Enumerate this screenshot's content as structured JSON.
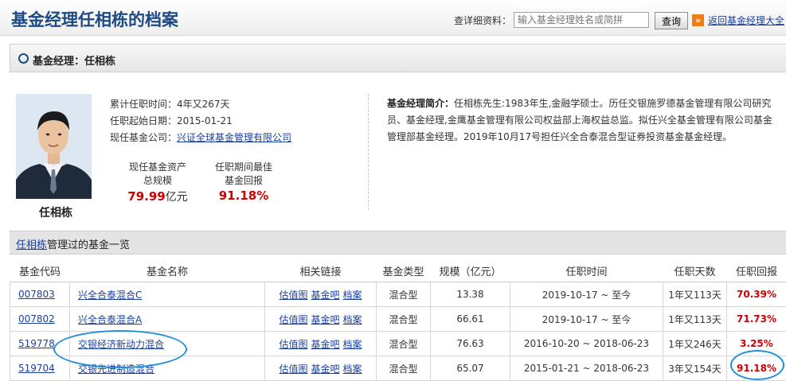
{
  "header": {
    "title": "基金经理任相栋的档案",
    "search_label": "查详细资料：",
    "search_placeholder": "输入基金经理姓名或简拼",
    "query_button": "查询",
    "back_link": "返回基金经理大全"
  },
  "manager_bar": {
    "title": "基金经理：任相栋"
  },
  "profile": {
    "name": "任相栋",
    "tenure_label": "累计任职时间：",
    "tenure_value": "4年又267天",
    "start_label": "任职起始日期：",
    "start_value": "2015-01-21",
    "company_label": "现任基金公司：",
    "company_value": "兴证全球基金管理有限公司",
    "stat_assets_label_1": "现任基金资产",
    "stat_assets_label_2": "总规模",
    "stat_assets_value": "79.99",
    "stat_assets_unit": "亿元",
    "stat_return_label_1": "任职期间最佳",
    "stat_return_label_2": "基金回报",
    "stat_return_value": "91.18%"
  },
  "bio": {
    "label": "基金经理简介：",
    "text": "任相栋先生:1983年生,金融学硕士。历任交银施罗德基金管理有限公司研究员、基金经理,金鹰基金管理有限公司权益部上海权益总监。拟任兴全基金管理有限公司基金管理部基金经理。2019年10月17号担任兴全合泰混合型证券投资基金基金经理。"
  },
  "fund_list": {
    "header_link": "任相栋",
    "header_suffix": "管理过的基金一览",
    "columns": [
      "基金代码",
      "基金名称",
      "相关链接",
      "基金类型",
      "规模（亿元）",
      "任职时间",
      "任职天数",
      "任职回报"
    ],
    "link_labels": [
      "估值图",
      "基金吧",
      "档案"
    ],
    "rows": [
      {
        "code": "007803",
        "name": "兴全合泰混合C",
        "type": "混合型",
        "size": "13.38",
        "period": "2019-10-17 ~ 至今",
        "days": "1年又113天",
        "return": "70.39%"
      },
      {
        "code": "007802",
        "name": "兴全合泰混合A",
        "type": "混合型",
        "size": "66.61",
        "period": "2019-10-17 ~ 至今",
        "days": "1年又113天",
        "return": "71.73%"
      },
      {
        "code": "519778",
        "name": "交银经济新动力混合",
        "type": "混合型",
        "size": "76.63",
        "period": "2016-10-20 ~ 2018-06-23",
        "days": "1年又246天",
        "return": "3.25%"
      },
      {
        "code": "519704",
        "name": "交银先进制造混合",
        "type": "混合型",
        "size": "65.07",
        "period": "2015-01-21 ~ 2018-06-23",
        "days": "3年又154天",
        "return": "91.18%"
      }
    ]
  },
  "colors": {
    "accent_blue": "#1e4a84",
    "return_red": "#d00000",
    "highlight_ring": "#1f8fd8",
    "link_blue": "#1a3fa0"
  }
}
